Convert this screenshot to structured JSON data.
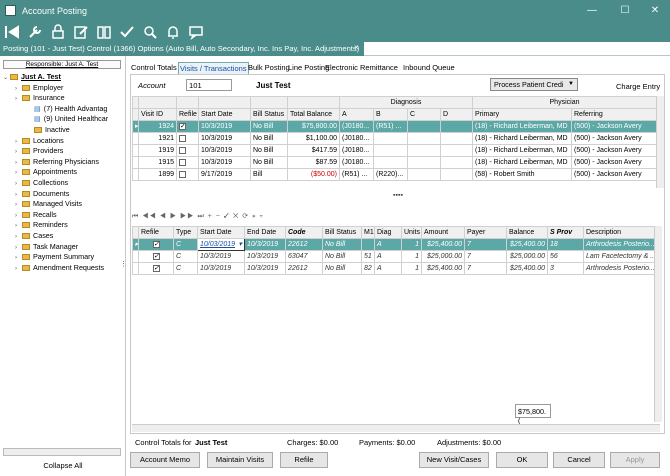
{
  "window": {
    "title": "Account Posting"
  },
  "doc_tab": {
    "label": "Posting (101 - Just Test)  Control (1366)  Options (Auto Bill, Auto Secondary, Inc. Ins Pay, Inc. Adjustments)",
    "close": "×"
  },
  "toolbar": {
    "icons": [
      "back-icon",
      "tools-icon",
      "lock-icon",
      "edit-icon",
      "book-icon",
      "check-icon",
      "search-icon",
      "bell-icon",
      "chat-icon"
    ]
  },
  "left": {
    "responsible": "Responsible: Just A. Test",
    "tree": [
      {
        "label": "Just A. Test",
        "level": 0,
        "bold": true
      },
      {
        "label": "Employer",
        "level": 1
      },
      {
        "label": "Insurance",
        "level": 1
      },
      {
        "label": "(7) Health Advantag",
        "level": 2
      },
      {
        "label": "(9) United Healthcar",
        "level": 2
      },
      {
        "label": "Inactive",
        "level": 2
      },
      {
        "label": "Locations",
        "level": 1
      },
      {
        "label": "Providers",
        "level": 1
      },
      {
        "label": "Referring Physicians",
        "level": 1
      },
      {
        "label": "Appointments",
        "level": 1
      },
      {
        "label": "Collections",
        "level": 1
      },
      {
        "label": "Documents",
        "level": 1
      },
      {
        "label": "Managed Visits",
        "level": 1
      },
      {
        "label": "Recalls",
        "level": 1
      },
      {
        "label": "Reminders",
        "level": 1
      },
      {
        "label": "Cases",
        "level": 1
      },
      {
        "label": "Task Manager",
        "level": 1
      },
      {
        "label": "Payment Summary",
        "level": 1
      },
      {
        "label": "Amendment Requests",
        "level": 1
      }
    ],
    "collapse": "Collapse All"
  },
  "subtabs": [
    "Control Totals",
    "Visits / Transactions",
    "Bulk Posting",
    "Line Posting",
    "Electronic Remittance",
    "Inbound Queue"
  ],
  "account": {
    "label": "Account",
    "value": "101",
    "name": "Just Test",
    "process_btn": "Process Patient Credi",
    "charge_entry": "Charge Entry"
  },
  "visits": {
    "group_headers": {
      "diagnosis": "Diagnosis",
      "physician": "Physician"
    },
    "columns": [
      "Visit ID",
      "Refile",
      "Start Date",
      "Bill Status",
      "Total Balance",
      "A",
      "B",
      "C",
      "D",
      "Primary",
      "Referring"
    ],
    "rows": [
      {
        "id": "1924",
        "refile": true,
        "date": "10/3/2019",
        "status": "No Bill",
        "bal": "$75,800.00",
        "a": "(J0180...",
        "b": "(R51) ...",
        "c": "",
        "d": "",
        "primary": "(18) - Richard Leiberman, MD",
        "referring": "(500) - Jackson Avery",
        "selected": true
      },
      {
        "id": "1921",
        "refile": false,
        "date": "10/3/2019",
        "status": "No Bill",
        "bal": "$1,100.00",
        "a": "(J0180...",
        "b": "",
        "c": "",
        "d": "",
        "primary": "(18) - Richard Leiberman, MD",
        "referring": "(500) - Jackson Avery"
      },
      {
        "id": "1919",
        "refile": false,
        "date": "10/3/2019",
        "status": "No Bill",
        "bal": "$417.59",
        "a": "(J0180...",
        "b": "",
        "c": "",
        "d": "",
        "primary": "(18) - Richard Leiberman, MD",
        "referring": "(500) - Jackson Avery"
      },
      {
        "id": "1915",
        "refile": false,
        "date": "10/3/2019",
        "status": "No Bill",
        "bal": "$87.59",
        "a": "(J0180...",
        "b": "",
        "c": "",
        "d": "",
        "primary": "(18) - Richard Leiberman, MD",
        "referring": "(500) - Jackson Avery"
      },
      {
        "id": "1899",
        "refile": false,
        "date": "9/17/2019",
        "status": "Bill",
        "bal": "($50.00)",
        "a": "(R51) ...",
        "b": "(R220)...",
        "c": "",
        "d": "",
        "primary": "(58) - Robert Smith",
        "referring": "(500) - Jackson Avery",
        "neg": true
      }
    ]
  },
  "lines": {
    "columns": [
      "Refile",
      "Type",
      "Start Date",
      "End Date",
      "Code",
      "Bill Status",
      "M1",
      "Diag",
      "Units",
      "Amount",
      "Payer",
      "Balance",
      "S Prov",
      "Description"
    ],
    "rows": [
      {
        "refile": true,
        "type": "C",
        "start": "10/03/2019",
        "end": "10/3/2019",
        "code": "22612",
        "status": "No Bill",
        "m1": "",
        "diag": "A",
        "units": "1",
        "amount": "$25,400.00",
        "payer": "7",
        "balance": "$25,400.00",
        "sprov": "18",
        "desc": "Arthrodesis Posterio...",
        "selected": true
      },
      {
        "refile": true,
        "type": "C",
        "start": "10/3/2019",
        "end": "10/3/2019",
        "code": "63047",
        "status": "No Bill",
        "m1": "51",
        "diag": "A",
        "units": "1",
        "amount": "$25,000.00",
        "payer": "7",
        "balance": "$25,000.00",
        "sprov": "56",
        "desc": "Lam Facetectomy & ..."
      },
      {
        "refile": true,
        "type": "C",
        "start": "10/3/2019",
        "end": "10/3/2019",
        "code": "22612",
        "status": "No Bill",
        "m1": "82",
        "diag": "A",
        "units": "1",
        "amount": "$25,400.00",
        "payer": "7",
        "balance": "$25,400.00",
        "sprov": "3",
        "desc": "Arthrodesis Posterio..."
      }
    ],
    "total": "$75,800.("
  },
  "control_totals": {
    "label": "Control Totals for",
    "name": "Just Test",
    "charges": "Charges: $0.00",
    "payments": "Payments: $0.00",
    "adjustments": "Adjustments: $0.00"
  },
  "buttons": {
    "memo": "Account Memo",
    "maintain": "Maintain Visits",
    "refile": "Refile",
    "new_visit": "New Visit/Cases",
    "ok": "OK",
    "cancel": "Cancel",
    "apply": "Apply"
  }
}
